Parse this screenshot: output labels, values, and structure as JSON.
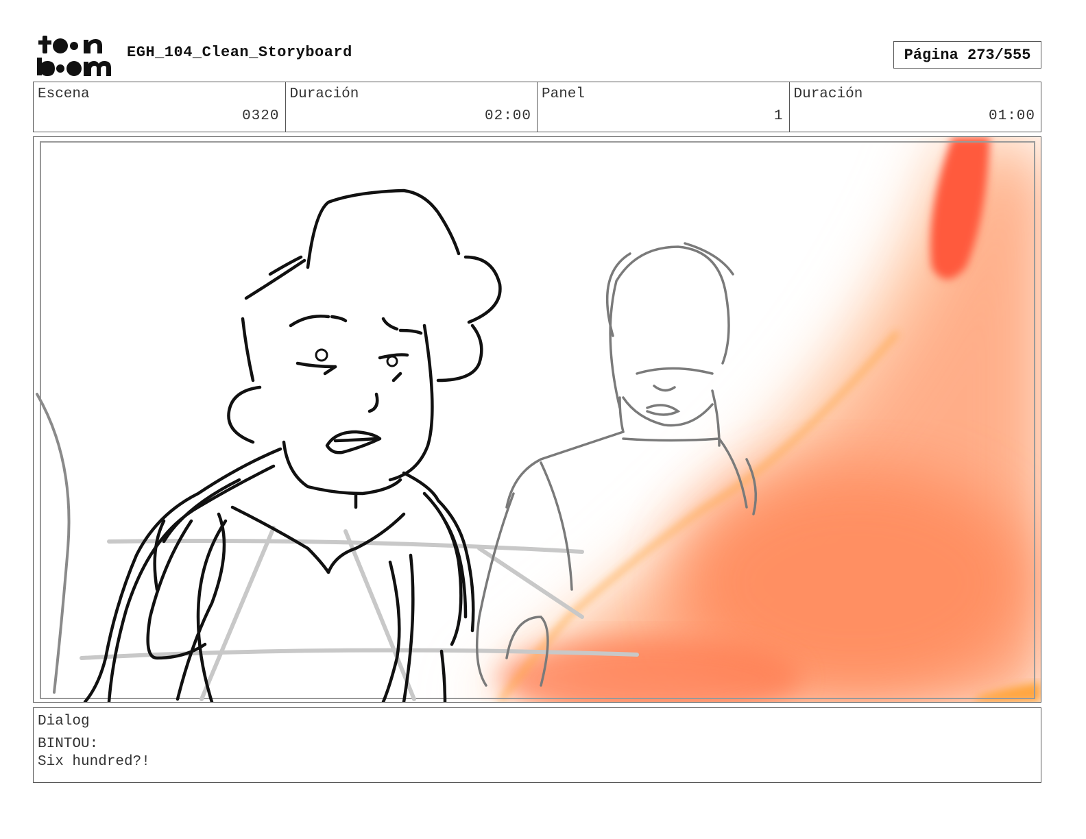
{
  "header": {
    "logo_text": "toon boom",
    "project_title": "EGH_104_Clean_Storyboard",
    "page_label": "Página",
    "page_value": "273/555"
  },
  "info": {
    "scene_label": "Escena",
    "scene_value": "0320",
    "scene_duration_label": "Duración",
    "scene_duration_value": "02:00",
    "panel_label": "Panel",
    "panel_value": "1",
    "panel_duration_label": "Duración",
    "panel_duration_value": "01:00"
  },
  "dialog": {
    "label": "Dialog",
    "speaker": "BINTOU:",
    "line": "Six hundred?!"
  },
  "colors": {
    "fire_orange": "#ff8a5c",
    "fire_red": "#ff5a3c",
    "fire_yellow": "#ffa640",
    "ink": "#111111",
    "sketch_grey": "#7a7a7a"
  }
}
